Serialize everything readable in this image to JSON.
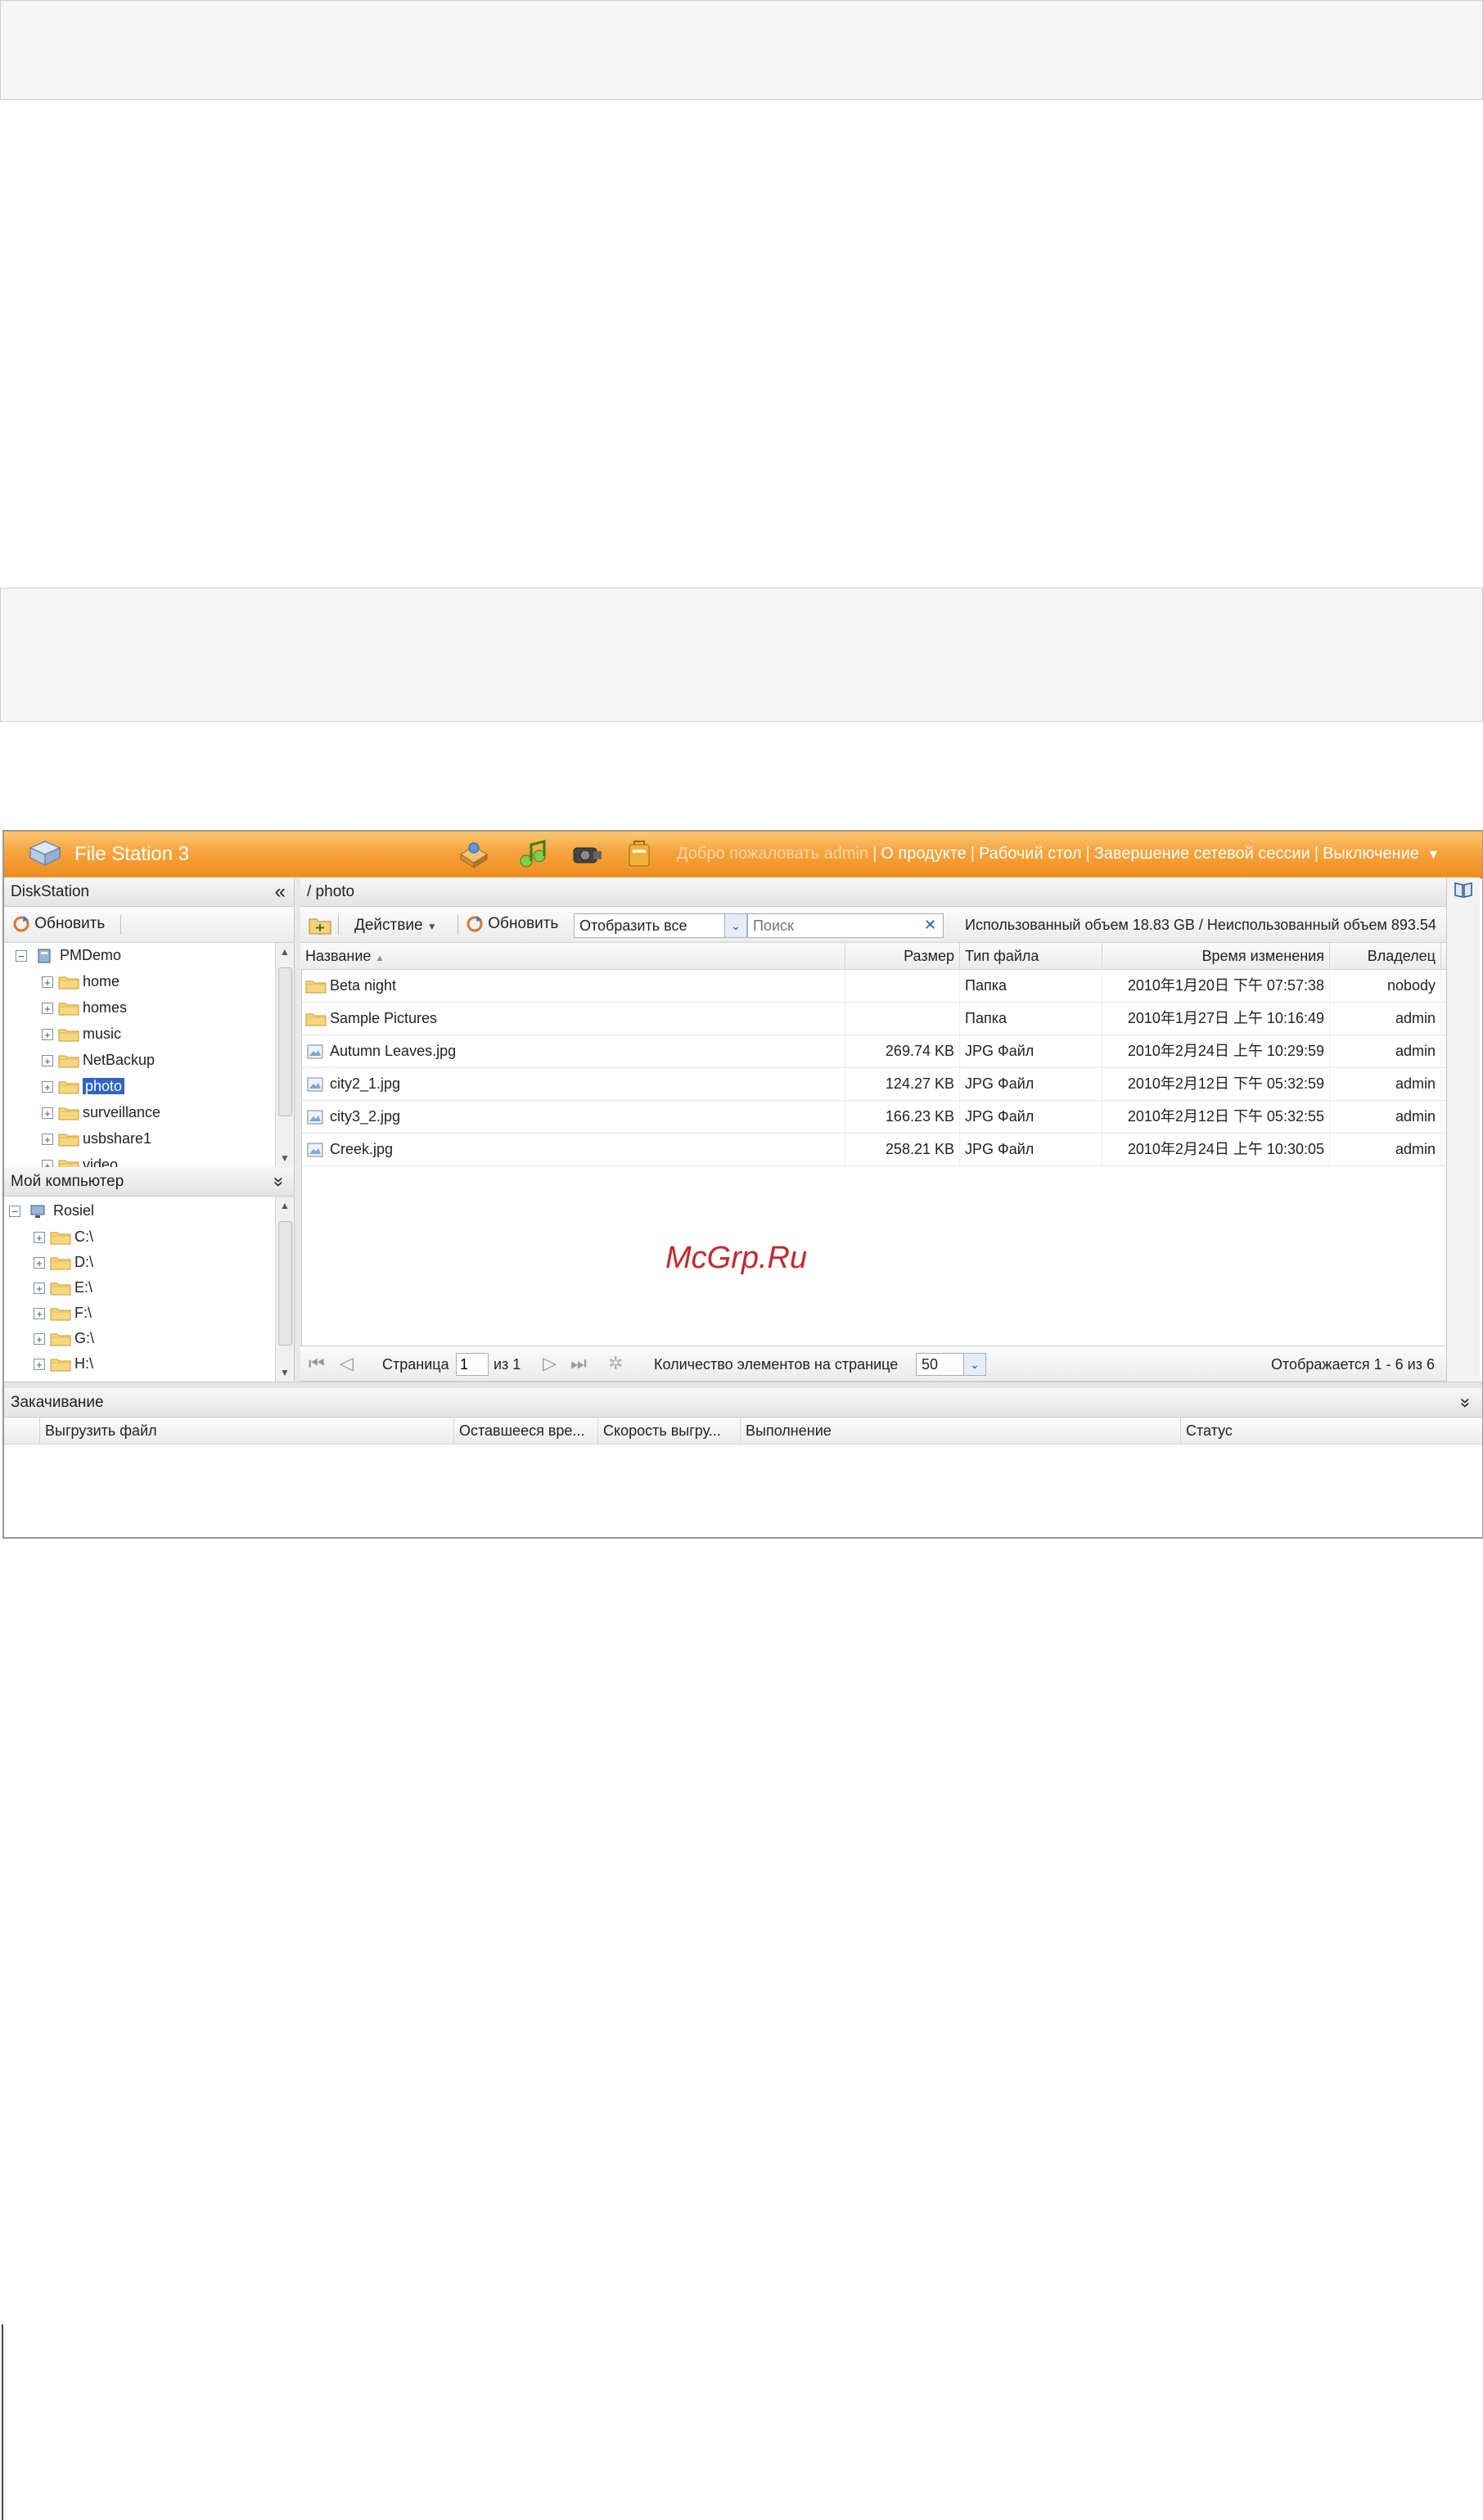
{
  "window": {
    "app_title": "File Station 3",
    "nav": [
      "Добро пожаловать admin",
      "О продукте",
      "Рабочий стол",
      "Завершение сетевой сессии",
      "Выключение"
    ],
    "nav_sep": "|",
    "dropdown_glyph": "▼"
  },
  "left": {
    "diskstation_title": "DiskStation",
    "collapse_glyph": "«",
    "refresh_label": "Обновить",
    "tree_root": "PMDemo",
    "tree_items": [
      "home",
      "homes",
      "music",
      "NetBackup",
      "photo",
      "surveillance",
      "usbshare1",
      "video"
    ],
    "selected_item": "photo",
    "mycomputer_title": "Мой компьютер",
    "expand_glyph": "»",
    "computer_root": "Rosiel",
    "drives": [
      "C:\\",
      "D:\\",
      "E:\\",
      "F:\\",
      "G:\\",
      "H:\\"
    ]
  },
  "main": {
    "path": "/ photo",
    "action_label": "Действие",
    "refresh_label": "Обновить",
    "view_select": "Отобразить все",
    "search_placeholder": "Поиск",
    "clear_glyph": "✕",
    "usage_text": "Использованный объем 18.83 GB / Неиспользованный объем 893.54",
    "columns": {
      "name": "Название",
      "size": "Размер",
      "type": "Тип файла",
      "modified": "Время изменения",
      "owner": "Владелец"
    },
    "sort_glyph": "▲",
    "rows": [
      {
        "name": "Beta night",
        "size": "",
        "type": "Папка",
        "modified": "2010年1月20日 下午 07:57:38",
        "owner": "nobody",
        "icon": "folder-icon"
      },
      {
        "name": "Sample Pictures",
        "size": "",
        "type": "Папка",
        "modified": "2010年1月27日 上午 10:16:49",
        "owner": "admin",
        "icon": "folder-icon"
      },
      {
        "name": "Autumn Leaves.jpg",
        "size": "269.74 KB",
        "type": "JPG Файл",
        "modified": "2010年2月24日 上午 10:29:59",
        "owner": "admin",
        "icon": "image-file-icon"
      },
      {
        "name": "city2_1.jpg",
        "size": "124.27 KB",
        "type": "JPG Файл",
        "modified": "2010年2月12日 下午 05:32:59",
        "owner": "admin",
        "icon": "image-file-icon"
      },
      {
        "name": "city3_2.jpg",
        "size": "166.23 KB",
        "type": "JPG Файл",
        "modified": "2010年2月12日 下午 05:32:55",
        "owner": "admin",
        "icon": "image-file-icon"
      },
      {
        "name": "Creek.jpg",
        "size": "258.21 KB",
        "type": "JPG Файл",
        "modified": "2010年2月24日 上午 10:30:05",
        "owner": "admin",
        "icon": "image-file-icon"
      }
    ],
    "watermark": "McGrp.Ru",
    "pager": {
      "page_label": "Страница",
      "page_value": "1",
      "of_label": "из 1",
      "per_page_label": "Количество элементов на странице",
      "per_page_value": "50",
      "display_text": "Отображается 1 - 6 из 6"
    }
  },
  "upload": {
    "title": "Закачивание",
    "columns": [
      "Выгрузить файл",
      "Оставшееся вре...",
      "Скорость выгру...",
      "Выполнение",
      "Статус"
    ]
  }
}
